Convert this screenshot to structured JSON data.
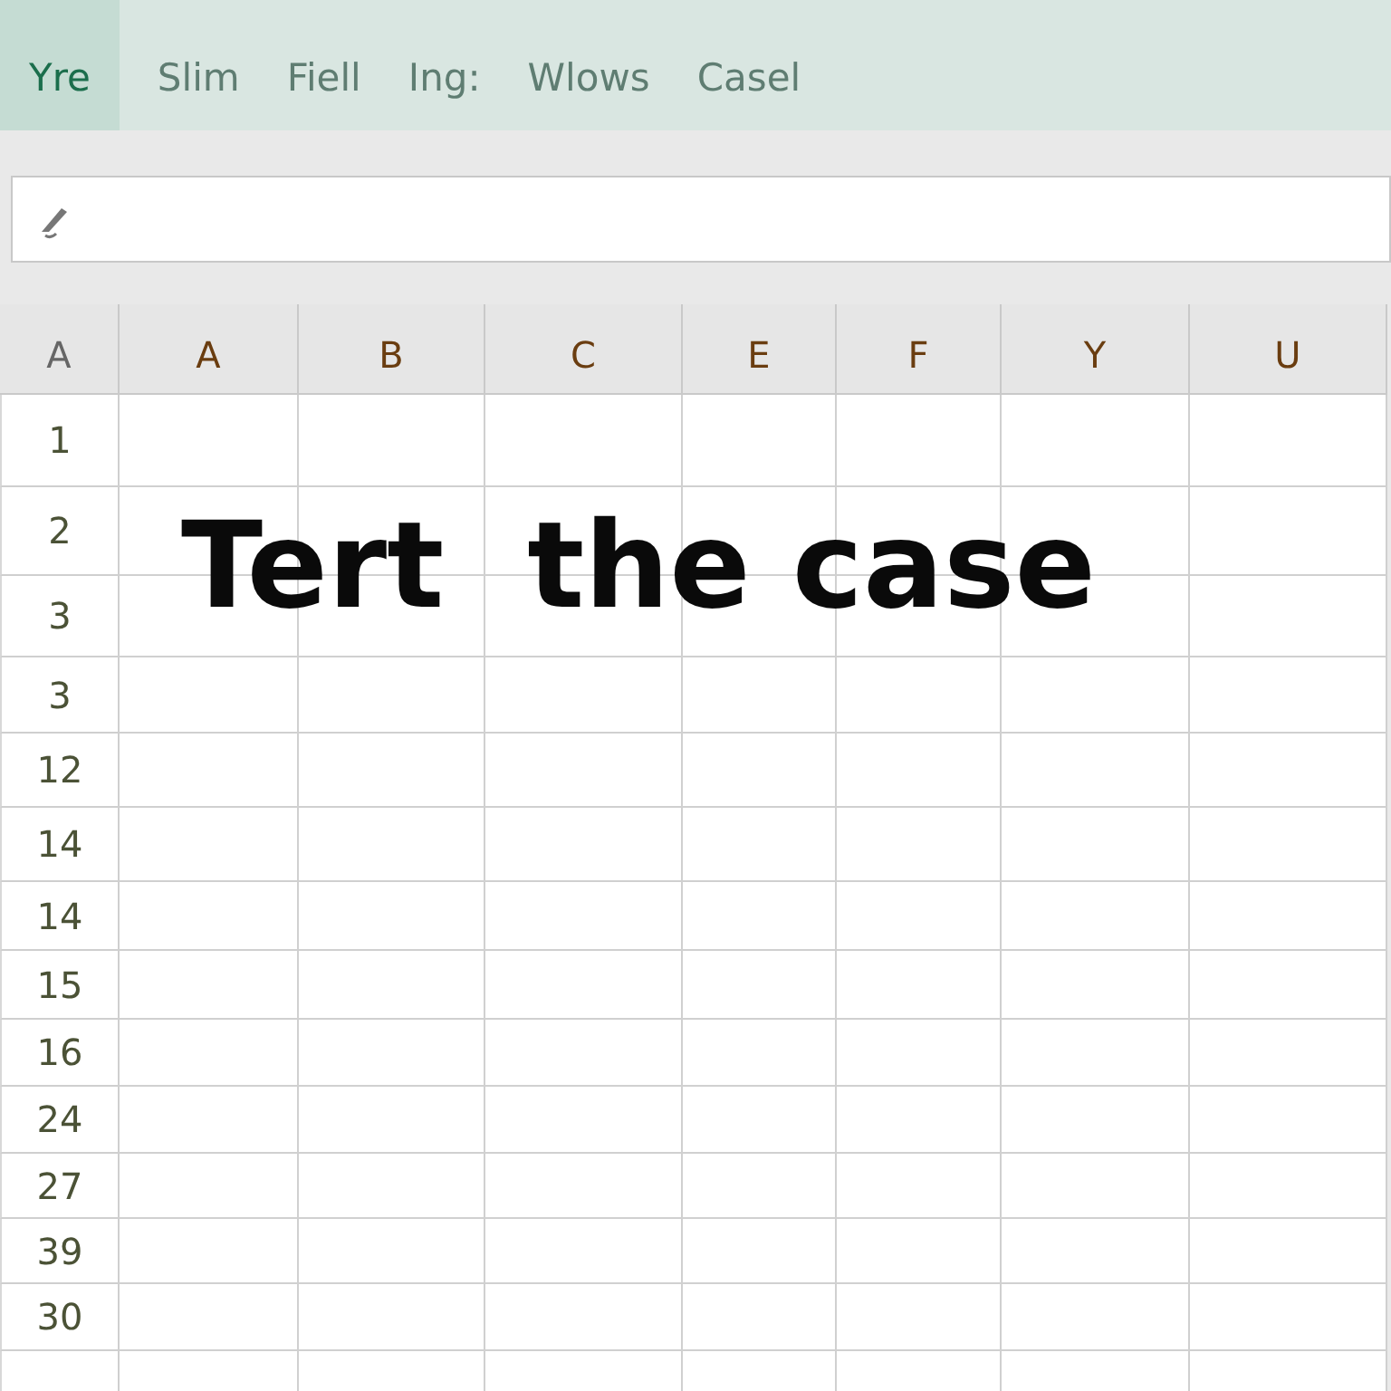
{
  "tabs": [
    {
      "label": "Yre",
      "selected": true
    },
    {
      "label": "Slim",
      "selected": false
    },
    {
      "label": "Fiell",
      "selected": false
    },
    {
      "label": "Ing:",
      "selected": false
    },
    {
      "label": "Wlows",
      "selected": false
    },
    {
      "label": "Casel",
      "selected": false
    }
  ],
  "corner_label": "A",
  "columns": [
    "A",
    "B",
    "C",
    "E",
    "F",
    "Y",
    "U"
  ],
  "rows": [
    "1",
    "2",
    "3",
    "3",
    "12",
    "14",
    "14",
    "15",
    "16",
    "24",
    "27",
    "39",
    "30"
  ],
  "overlay_text": "Tert  the case"
}
